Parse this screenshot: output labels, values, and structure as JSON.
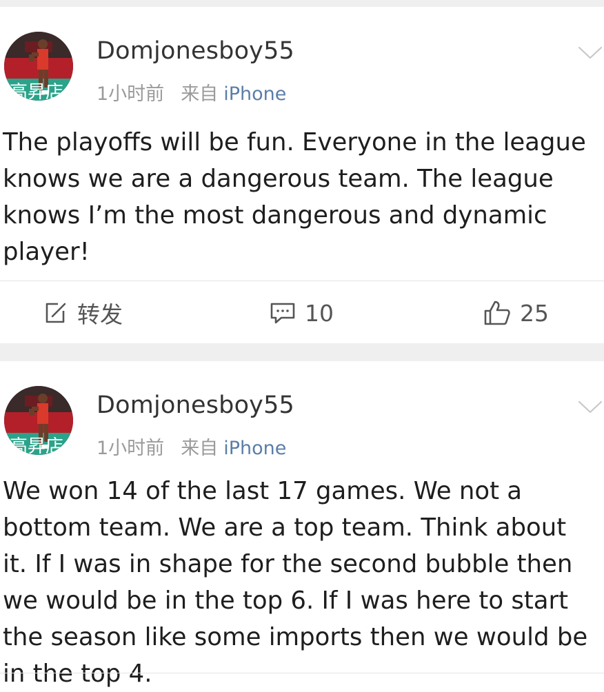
{
  "posts": [
    {
      "username": "Domjonesboy55",
      "time": "1小时前",
      "source_prefix": "来自",
      "device": "iPhone",
      "text": "The playoffs will be fun. Everyone in the league knows we are a dangerous team. The league knows I’m the most dangerous and dynamic player!",
      "repost_label": "转发",
      "comment_count": "10",
      "like_count": "25",
      "avatar_caption": "高昇店"
    },
    {
      "username": "Domjonesboy55",
      "time": "1小时前",
      "source_prefix": "来自",
      "device": "iPhone",
      "text": "We won 14 of the last 17 games. We not a bottom team. We are a top team. Think about it. If I was in shape for the second bubble then we would be in the top 6. If I was here to start the season like some imports then we would be in the top 4.",
      "avatar_caption": "高昇店"
    }
  ],
  "colors": {
    "background": "#efefef",
    "card": "#ffffff",
    "text": "#1e1e1e",
    "meta": "#9a9a9a",
    "device_link": "#5b7da8",
    "jersey": "#d93a2b",
    "banner_teal": "#2aa38a"
  },
  "icons": {
    "repost": "compose-share-icon",
    "comment": "comment-bubble-icon",
    "like": "thumbs-up-icon",
    "menu": "chevron-down-icon"
  }
}
